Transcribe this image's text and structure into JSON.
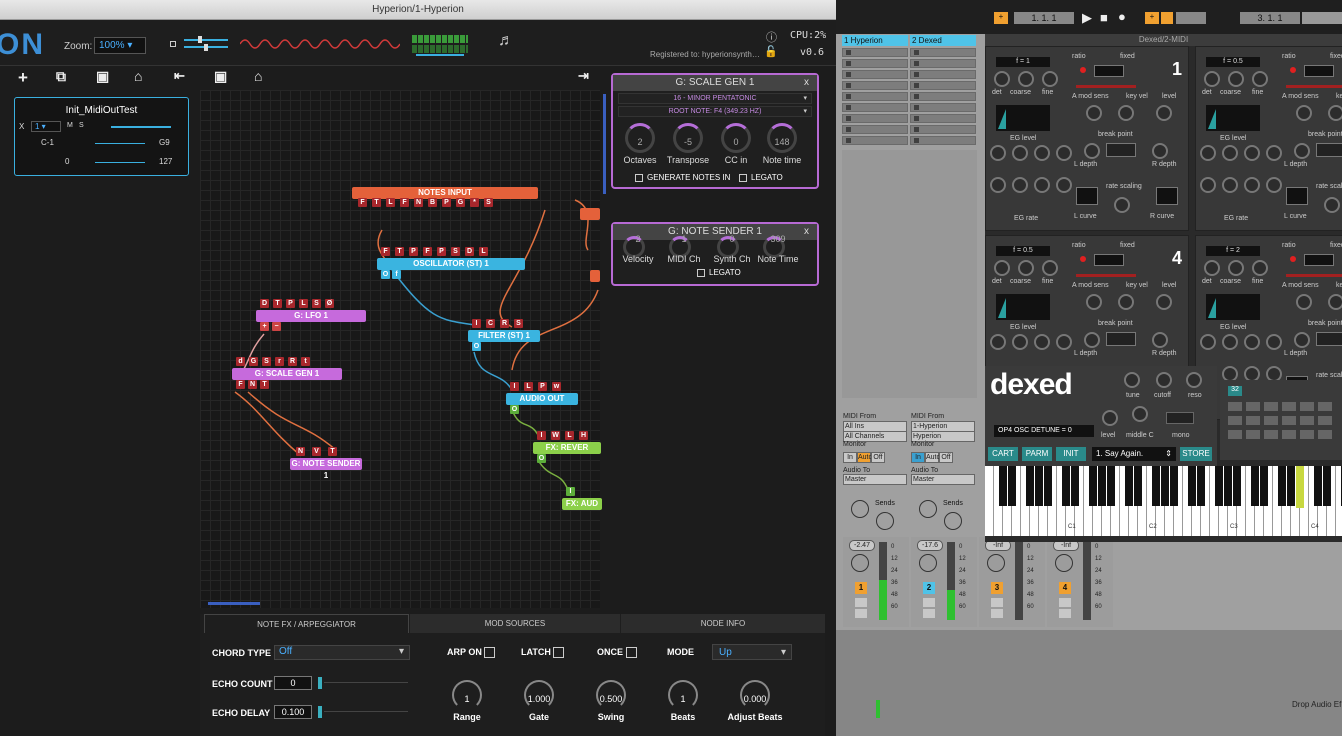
{
  "hyperion": {
    "title": "Hyperion/1-Hyperion",
    "logo": "ON",
    "zoom_label": "Zoom:",
    "zoom_value": "100%",
    "cpu": "CPU:2%",
    "registered": "Registered to: hyperionsynth…",
    "version": "v0.6",
    "preset": {
      "name": "Init_MidiOutTest",
      "x_label": "X",
      "x_value": "1",
      "m": "M",
      "s": "S",
      "low_note": "C-1",
      "high_note": "G9",
      "low_val": "0",
      "high_val": "127"
    },
    "nodes": {
      "notes_input": "NOTES INPUT",
      "oscillator": "OSCILLATOR (ST) 1",
      "lfo": "G: LFO 1",
      "scale_gen": "G: SCALE GEN 1",
      "filter": "FILTER (ST) 1",
      "audio_out": "AUDIO OUT",
      "fx_reverb": "FX: REVER",
      "fx_audio": "FX: AUD",
      "note_sender": "G: NOTE SENDER 1"
    },
    "pins": {
      "notes_input": [
        "F",
        "T",
        "L",
        "F",
        "N",
        "B",
        "P",
        "G",
        "*",
        "S"
      ],
      "oscillator": [
        "F",
        "T",
        "P",
        "F",
        "P",
        "S",
        "D",
        "L"
      ],
      "osc_out": [
        "O",
        "f"
      ],
      "lfo": [
        "D",
        "T",
        "P",
        "L",
        "S",
        "Ø"
      ],
      "lfo_out": [
        "+",
        "−"
      ],
      "scale": [
        "d",
        "G",
        "S",
        "r",
        "R",
        "t"
      ],
      "scale_out": [
        "F",
        "N",
        "T"
      ],
      "filter": [
        "I",
        "C",
        "R",
        "S"
      ],
      "filter_out": [
        "O"
      ],
      "audio_out": [
        "I",
        "L",
        "P",
        "w"
      ],
      "audio_out_o": [
        "O"
      ],
      "reverb": [
        "I",
        "W",
        "L",
        "H"
      ],
      "reverb_o": [
        "O"
      ],
      "fxaud": [
        "I"
      ],
      "sender": [
        "N",
        "V",
        "T"
      ]
    },
    "scale_panel": {
      "title": "G: SCALE GEN 1",
      "close": "x",
      "scale": "16 - MINOR PENTATONIC",
      "root": "ROOT NOTE: F4 (349.23 HZ)",
      "knobs": [
        {
          "label": "Octaves",
          "value": "2"
        },
        {
          "label": "Transpose",
          "value": "-5"
        },
        {
          "label": "CC in",
          "value": "0"
        },
        {
          "label": "Note time",
          "value": "148"
        }
      ],
      "gen_label": "GENERATE NOTES IN",
      "legato": "LEGATO"
    },
    "sender_panel": {
      "title": "G: NOTE SENDER 1",
      "close": "x",
      "knobs": [
        {
          "label": "Velocity",
          "value": "2"
        },
        {
          "label": "MIDI Ch",
          "value": "1"
        },
        {
          "label": "Synth Ch",
          "value": "0"
        },
        {
          "label": "Note Time",
          "value": "309"
        }
      ],
      "legato": "LEGATO"
    },
    "bottom": {
      "tabs": [
        "NOTE FX / ARPEGGIATOR",
        "MOD SOURCES",
        "NODE INFO"
      ],
      "chord_type_label": "CHORD TYPE",
      "chord_type": "Off",
      "echo_count_label": "ECHO COUNT",
      "echo_count": "0",
      "echo_delay_label": "ECHO DELAY",
      "echo_delay": "0.100",
      "arp_on": "ARP ON",
      "latch": "LATCH",
      "once": "ONCE",
      "mode_label": "MODE",
      "mode": "Up",
      "knobs": [
        {
          "label": "Range",
          "value": "1"
        },
        {
          "label": "Gate",
          "value": "1.000"
        },
        {
          "label": "Swing",
          "value": "0.500"
        },
        {
          "label": "Beats",
          "value": "1"
        },
        {
          "label": "Adjust Beats",
          "value": "0.000"
        }
      ]
    }
  },
  "ableton": {
    "transport_pos": "1.  1.  1",
    "transport_pos2": "3.  1.  1",
    "tracks": [
      {
        "name": "1 Hyperion",
        "color": "#4fc3e8"
      },
      {
        "name": "2 Dexed",
        "color": "#4fc3e8"
      }
    ],
    "io": [
      {
        "midi_from": "MIDI From",
        "src": "All Ins",
        "ch": "All Channels",
        "monitor": "Monitor",
        "in": "In",
        "auto": "Auto",
        "off": "Off",
        "audio_to": "Audio To",
        "dest": "Master"
      },
      {
        "midi_from": "MIDI From",
        "src": "1-Hyperion",
        "ch": "Hyperion",
        "monitor": "Monitor",
        "in": "In",
        "auto": "Auto",
        "off": "Off",
        "audio_to": "Audio To",
        "dest": "Master"
      }
    ],
    "sends": "Sends",
    "mixer": [
      {
        "vol": "-2.47",
        "num": "1",
        "color": "#f0a030"
      },
      {
        "vol": "-17.6",
        "num": "2",
        "color": "#4fc3e8"
      },
      {
        "vol": "-Inf",
        "num": "3",
        "color": "#f0a030"
      },
      {
        "vol": "-Inf",
        "num": "4",
        "color": "#f0a030"
      }
    ],
    "db_scale": [
      "0",
      "12",
      "24",
      "36",
      "48",
      "60"
    ],
    "drop_text": "Drop Audio Ef"
  },
  "dexed": {
    "title": "Dexed/2-MIDI",
    "ops": [
      {
        "freq": "f = 1",
        "num": "1"
      },
      {
        "freq": "f = 0.5",
        "num": ""
      },
      {
        "freq": "f = 0.5",
        "num": "4"
      },
      {
        "freq": "f = 2",
        "num": ""
      }
    ],
    "labels": {
      "ratio": "ratio",
      "fixed": "fixed",
      "det": "det",
      "coarse": "coarse",
      "fine": "fine",
      "amod": "A mod sens",
      "keyvel": "key vel",
      "level": "level",
      "eglevel": "EG level",
      "breakpoint": "break point",
      "ldepth": "L depth",
      "rdepth": "R depth",
      "ratescaling": "rate scaling",
      "egrate": "EG rate",
      "lcurve": "L curve",
      "rcurve": "R curve"
    },
    "brand": "dexed",
    "tune": "tune",
    "cutoff": "cutoff",
    "reso": "reso",
    "param_display": "OP4 OSC DETUNE = 0",
    "level": "level",
    "middlec": "middle C",
    "mono": "mono",
    "cart": "CART",
    "parm": "PARM",
    "init": "INIT",
    "program": "1. Say Again.",
    "store": "STORE",
    "algo": "32",
    "octaves": [
      "C1",
      "C2",
      "C3",
      "C4"
    ]
  }
}
